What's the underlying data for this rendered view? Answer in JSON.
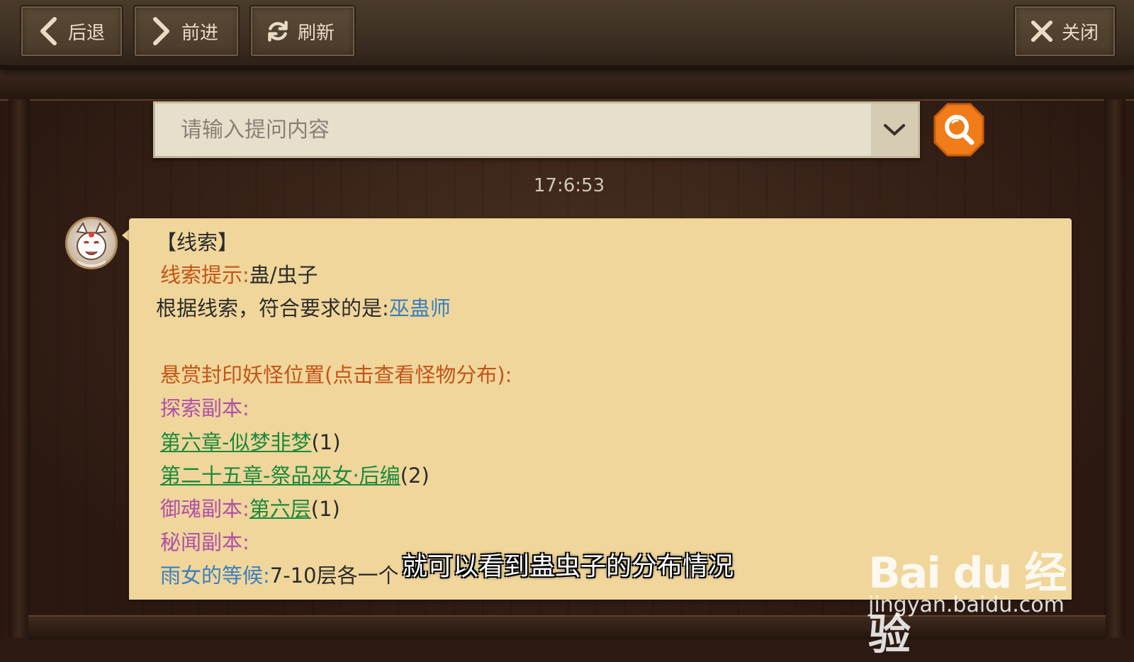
{
  "toolbar": {
    "back_label": "后退",
    "forward_label": "前进",
    "refresh_label": "刷新",
    "close_label": "关闭"
  },
  "search": {
    "placeholder": "请输入提问内容",
    "value": ""
  },
  "chat": {
    "timestamp": "17:6:53",
    "message": {
      "heading": "【线索】",
      "hint_label": "线索提示:",
      "hint_value": "蛊/虫子",
      "answer_label": "根据线索，符合要求的是:",
      "answer_value": "巫蛊师",
      "location_heading": "悬赏封印妖怪位置(点击查看怪物分布):",
      "explore_label": "探索副本:",
      "explore_items": [
        {
          "link": "第六章-似梦非梦",
          "count": "(1)"
        },
        {
          "link": "第二十五章-祭品巫女·后编",
          "count": "(2)"
        }
      ],
      "soul_label": "御魂副本:",
      "soul_link": "第六层",
      "soul_count": "(1)",
      "secret_label": "秘闻副本:",
      "rain_label": "雨女的等候:",
      "rain_value": "7-10层各一个"
    }
  },
  "overlay": {
    "subtitle": "就可以看到蛊虫子的分布情况",
    "watermark_logo": "Bai du 经验",
    "watermark_url": "jingyan.baidu.com"
  },
  "colors": {
    "bubble": "#f0d69b",
    "orange_text": "#c35417",
    "purple_text": "#b050a8",
    "link_green": "#1a8a3c",
    "link_blue": "#3a7fbf",
    "search_button": "#f07c1a"
  }
}
